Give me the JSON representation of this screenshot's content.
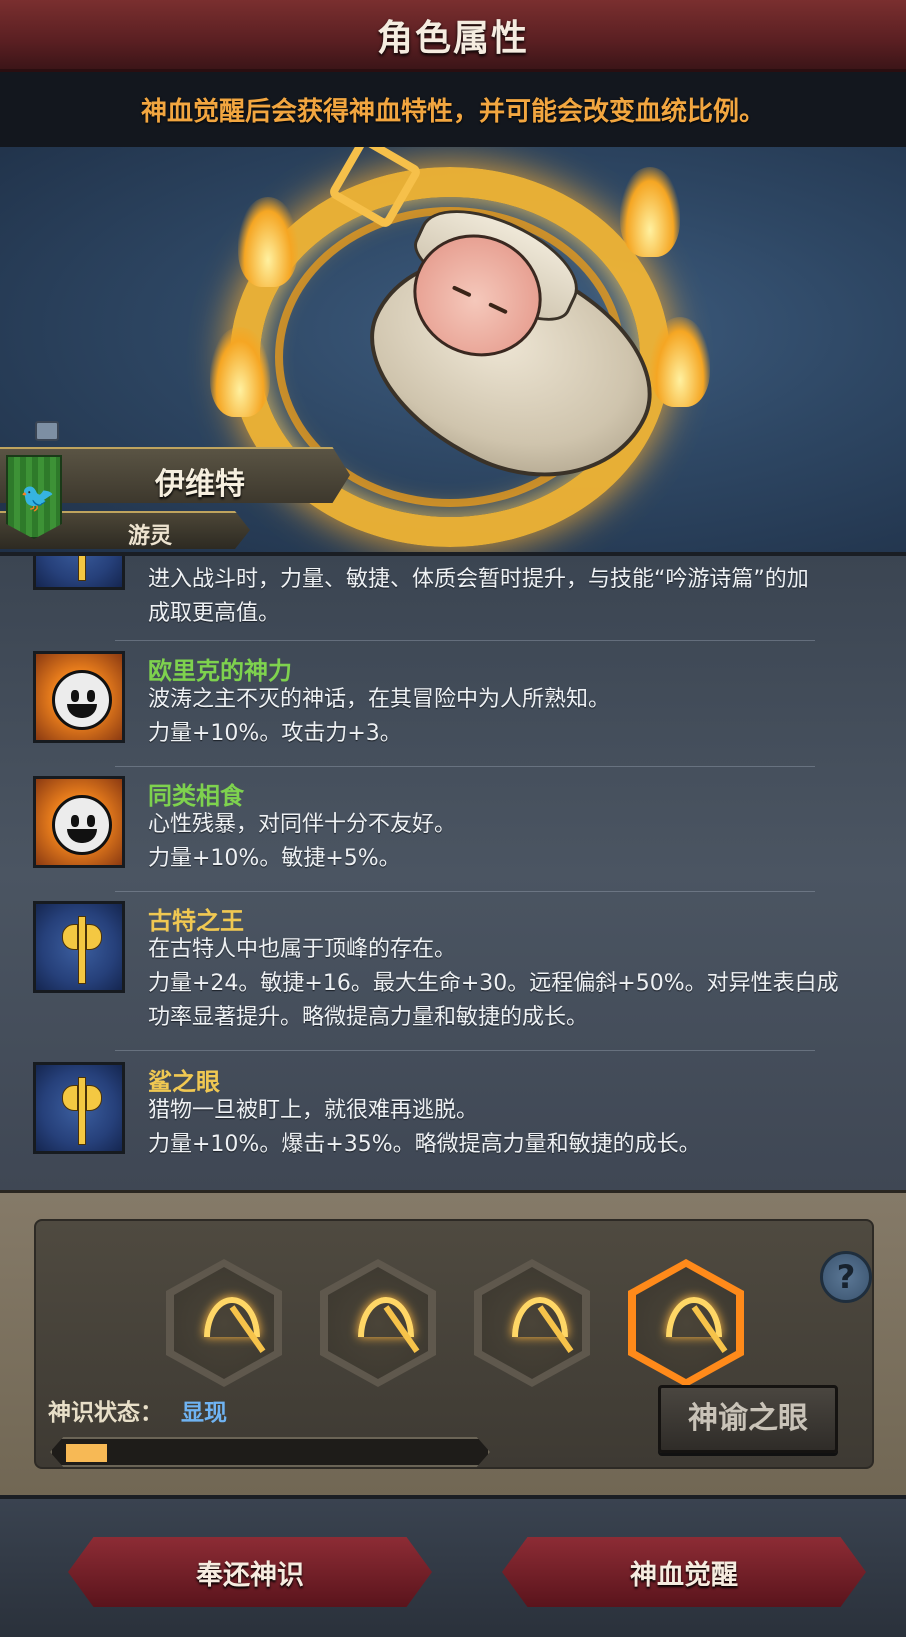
{
  "header": {
    "title": "角色属性"
  },
  "hint": "神血觉醒后会获得神血特性，并可能会改变血统比例。",
  "character": {
    "name": "伊维特",
    "class": "游灵"
  },
  "traits": [
    {
      "name": "",
      "icon": "axe-icon",
      "color": "gold",
      "lines": [
        "进入战斗时，力量、敏捷、体质会暂时提升，与技能“吟游诗篇”的加",
        "成取更高值。"
      ]
    },
    {
      "name": "欧里克的神力",
      "icon": "smile-sun-icon",
      "color": "green",
      "lines": [
        "波涛之主不灭的神话，在其冒险中为人所熟知。",
        "力量+10%。攻击力+3。"
      ]
    },
    {
      "name": "同类相食",
      "icon": "smile-sun-icon",
      "color": "green",
      "lines": [
        "心性残暴，对同伴十分不友好。",
        "力量+10%。敏捷+5%。"
      ]
    },
    {
      "name": "古特之王",
      "icon": "axe-icon",
      "color": "gold",
      "lines": [
        "在古特人中也属于顶峰的存在。",
        "力量+24。敏捷+16。最大生命+30。远程偏斜+50%。对异性表白成",
        "功率显著提升。略微提高力量和敏捷的成长。"
      ]
    },
    {
      "name": "鲨之眼",
      "icon": "axe-icon",
      "color": "gold",
      "lines": [
        "猎物一旦被盯上，就很难再逃脱。",
        "力量+10%。爆击+35%。略微提高力量和敏捷的成长。"
      ]
    }
  ],
  "divine": {
    "slots": 4,
    "active_slot": 4,
    "status_label": "神识状态：",
    "status_value": "显现",
    "progress": 0.1,
    "oracle_button": "神谕之眼",
    "help_icon": "question-icon"
  },
  "actions": {
    "return_label": "奉还神识",
    "awaken_label": "神血觉醒"
  },
  "colors": {
    "accent_orange": "#f2a640",
    "status_blue": "#6fb3f2",
    "button_red": "#8d2c35"
  }
}
